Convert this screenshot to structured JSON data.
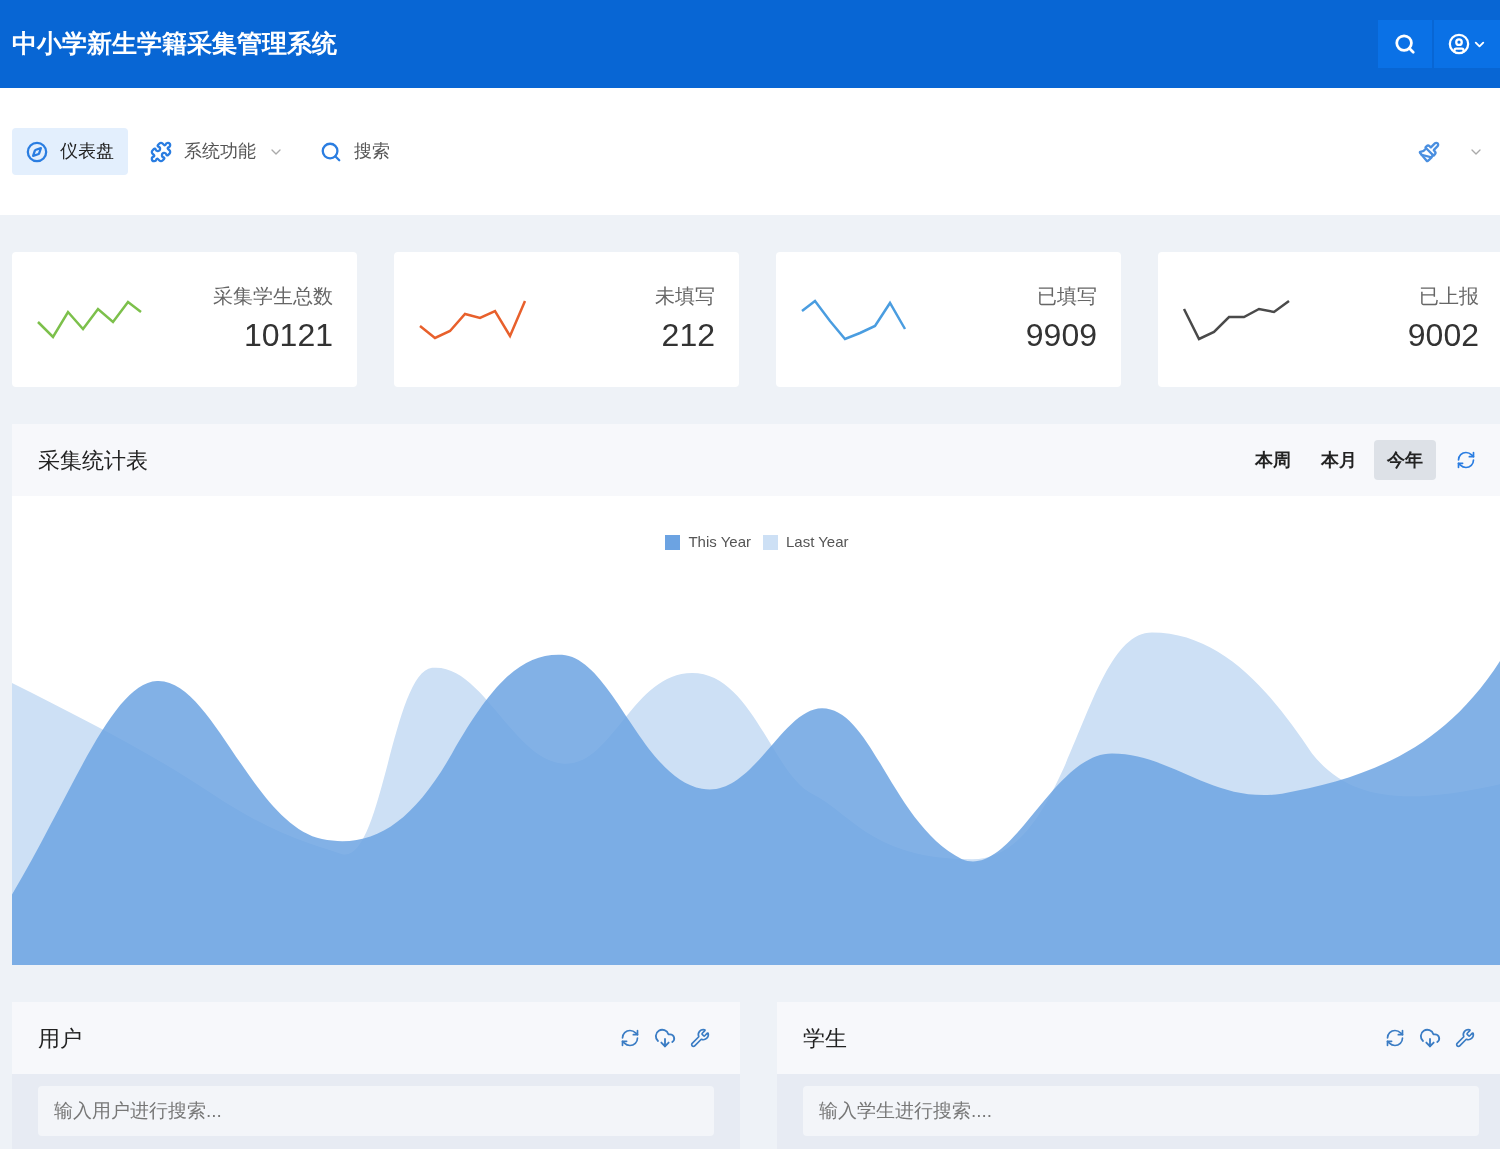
{
  "header": {
    "title": "中小学新生学籍采集管理系统"
  },
  "nav": {
    "items": [
      {
        "kind": "dashboard",
        "label": "仪表盘",
        "selected": true,
        "dropdown": false
      },
      {
        "kind": "functions",
        "label": "系统功能",
        "selected": false,
        "dropdown": true
      },
      {
        "kind": "search",
        "label": "搜索",
        "selected": false,
        "dropdown": false
      }
    ]
  },
  "stats": [
    {
      "label": "采集学生总数",
      "value": "10121",
      "color": "#7cc04b"
    },
    {
      "label": "未填写",
      "value": "212",
      "color": "#e8602c"
    },
    {
      "label": "已填写",
      "value": "9909",
      "color": "#4a9de0"
    },
    {
      "label": "已上报",
      "value": "9002",
      "color": "#4a4a4a"
    }
  ],
  "chart_panel": {
    "title": "采集统计表",
    "tabs": [
      {
        "label": "本周",
        "selected": false
      },
      {
        "label": "本月",
        "selected": false
      },
      {
        "label": "今年",
        "selected": true
      }
    ],
    "legend": [
      {
        "label": "This Year",
        "color": "#6ca3e2"
      },
      {
        "label": "Last Year",
        "color": "#cde0f5"
      }
    ]
  },
  "panels": [
    {
      "title": "用户",
      "placeholder": "输入用户进行搜索..."
    },
    {
      "title": "学生",
      "placeholder": "输入学生进行搜索...."
    }
  ]
}
